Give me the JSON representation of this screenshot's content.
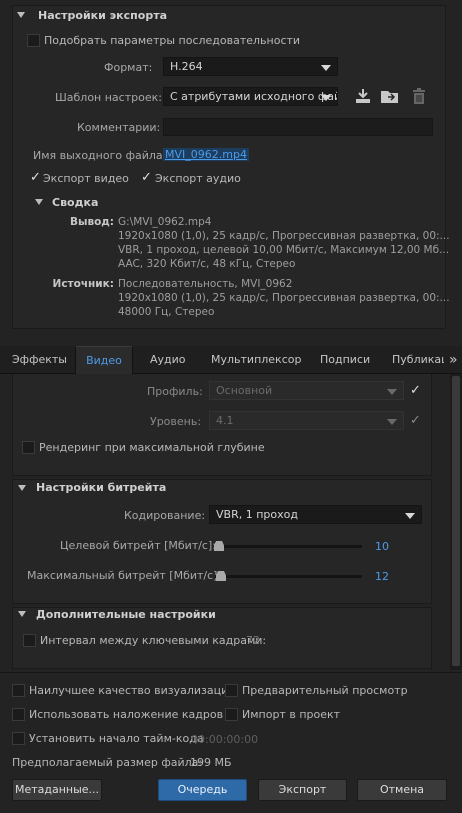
{
  "export_settings": {
    "title": "Настройки экспорта",
    "match_sequence": "Подобрать параметры последовательности",
    "format_label": "Формат:",
    "format_value": "H.264",
    "preset_label": "Шаблон настроек:",
    "preset_value": "С атрибутами исходного файла",
    "comments_label": "Комментарии:",
    "output_label": "Имя выходного файла:",
    "output_value": "MVI_0962.mp4",
    "export_video": "Экспорт видео",
    "export_audio": "Экспорт аудио"
  },
  "summary": {
    "title": "Сводка",
    "output_label": "Вывод:",
    "output_lines": [
      "G:\\MVI_0962.mp4",
      "1920x1080 (1,0), 25 кадр/с, Прогрессивная развертка, 00:...",
      "VBR, 1 проход, целевой 10,00 Мбит/с, Максимум 12,00 Мб...",
      "AAC, 320 Кбит/с, 48 кГц, Стерео"
    ],
    "source_label": "Источник:",
    "source_lines": [
      "Последовательность, MVI_0962",
      "1920x1080 (1,0), 25 кадр/с, Прогрессивная развертка, 00:...",
      "48000 Гц, Стерео"
    ]
  },
  "tabs": [
    "Эффекты",
    "Видео",
    "Аудио",
    "Мультиплексор",
    "Подписи",
    "Публикац"
  ],
  "tabs_more": "»",
  "video": {
    "profile_label": "Профиль:",
    "profile_value": "Основной",
    "level_label": "Уровень:",
    "level_value": "4.1",
    "max_depth": "Рендеринг при максимальной глубине"
  },
  "bitrate": {
    "title": "Настройки битрейта",
    "encoding_label": "Кодирование:",
    "encoding_value": "VBR, 1 проход",
    "target_label": "Целевой битрейт [Мбит/с]:",
    "target_value": "10",
    "max_label": "Максимальный битрейт [Мбит/с]:",
    "max_value": "12"
  },
  "advanced": {
    "title": "Дополнительные настройки",
    "keyframe_label": "Интервал между ключевыми кадрами:",
    "keyframe_value": "72"
  },
  "bottom": {
    "max_quality": "Наилучшее качество визуализации",
    "preview": "Предварительный просмотр",
    "frame_blending": "Использовать наложение кадров",
    "import_project": "Импорт в проект",
    "set_timecode": "Установить начало тайм-кода",
    "timecode_value": "00:00:00:00",
    "file_size_label": "Предполагаемый размер файла:",
    "file_size_value": "199 МБ"
  },
  "buttons": {
    "metadata": "Метаданные...",
    "queue": "Очередь",
    "export": "Экспорт",
    "cancel": "Отмена"
  },
  "colors": {
    "accent": "#4c9be8",
    "primary_button": "#2f6aa8",
    "background": "#232323"
  }
}
